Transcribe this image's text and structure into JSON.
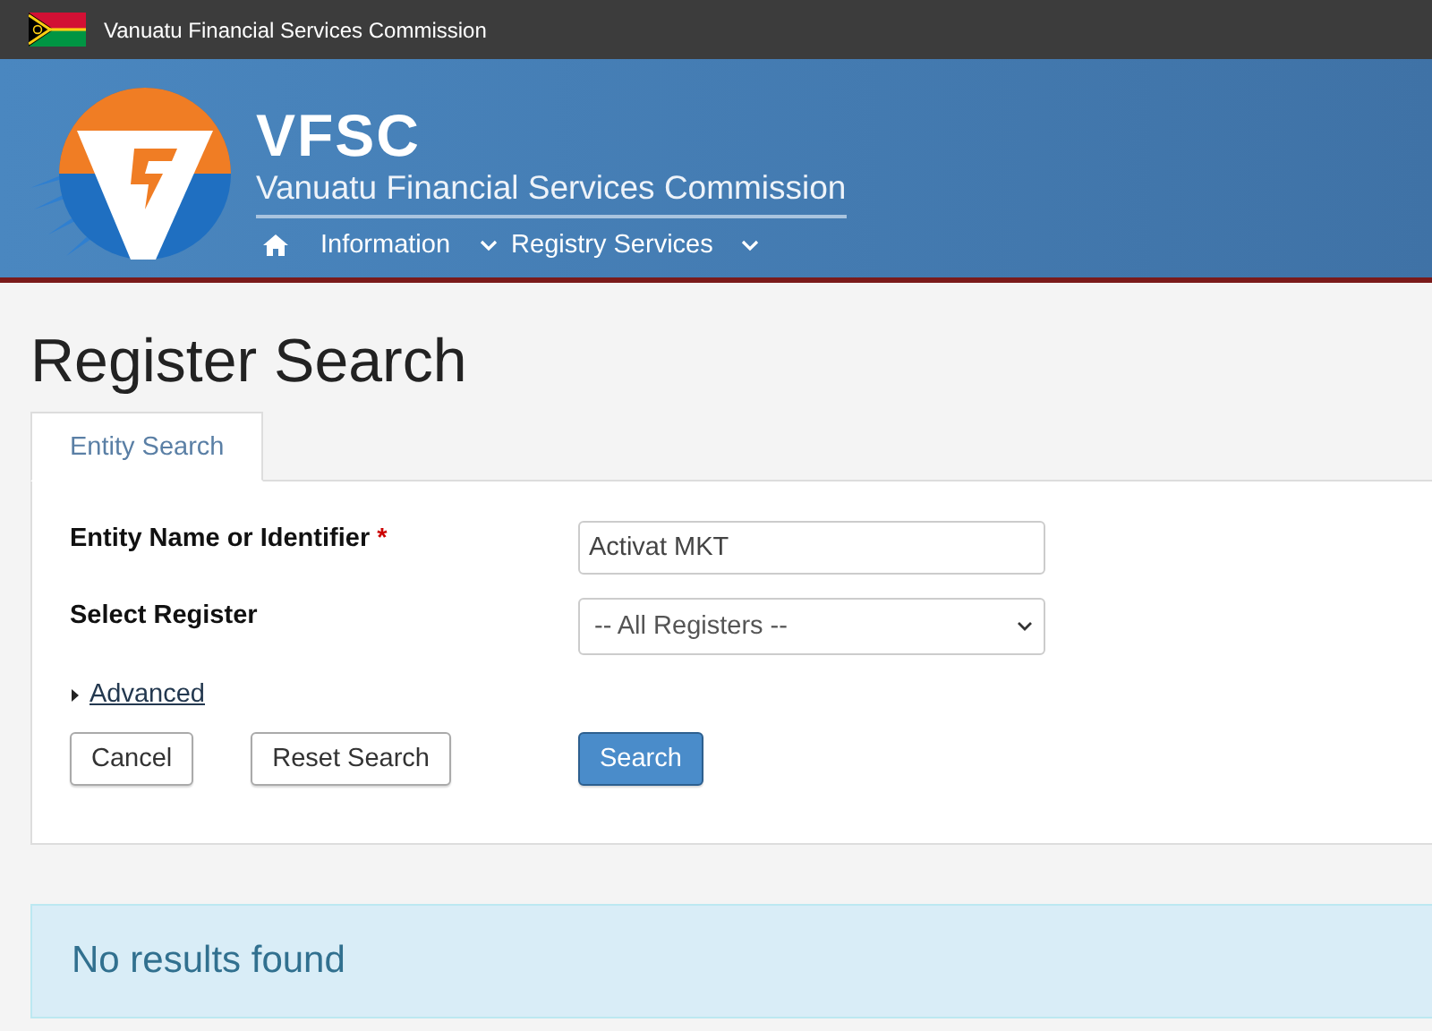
{
  "top_bar": {
    "title": "Vanuatu Financial Services Commission"
  },
  "header": {
    "acronym": "VFSC",
    "name": "Vanuatu Financial Services Commission",
    "nav": [
      {
        "kind": "home"
      },
      {
        "kind": "dropdown",
        "label": "Information"
      },
      {
        "kind": "dropdown",
        "label": "Registry Services"
      }
    ]
  },
  "page_title": "Register Search",
  "tabs": [
    {
      "label": "Entity Search",
      "selected": true
    }
  ],
  "fields": [
    {
      "kind": "text",
      "label": "Entity Name or Identifier",
      "required_mark": "*",
      "value": "Activat MKT"
    },
    {
      "kind": "select",
      "label": "Select Register",
      "value": "-- All Registers --"
    }
  ],
  "advanced": {
    "label": "Advanced",
    "expanded": false
  },
  "buttons": [
    {
      "kind": "default",
      "label": "Cancel"
    },
    {
      "kind": "default",
      "label": "Reset Search"
    },
    {
      "kind": "primary",
      "label": "Search"
    }
  ],
  "alert": {
    "text": "No results found"
  }
}
